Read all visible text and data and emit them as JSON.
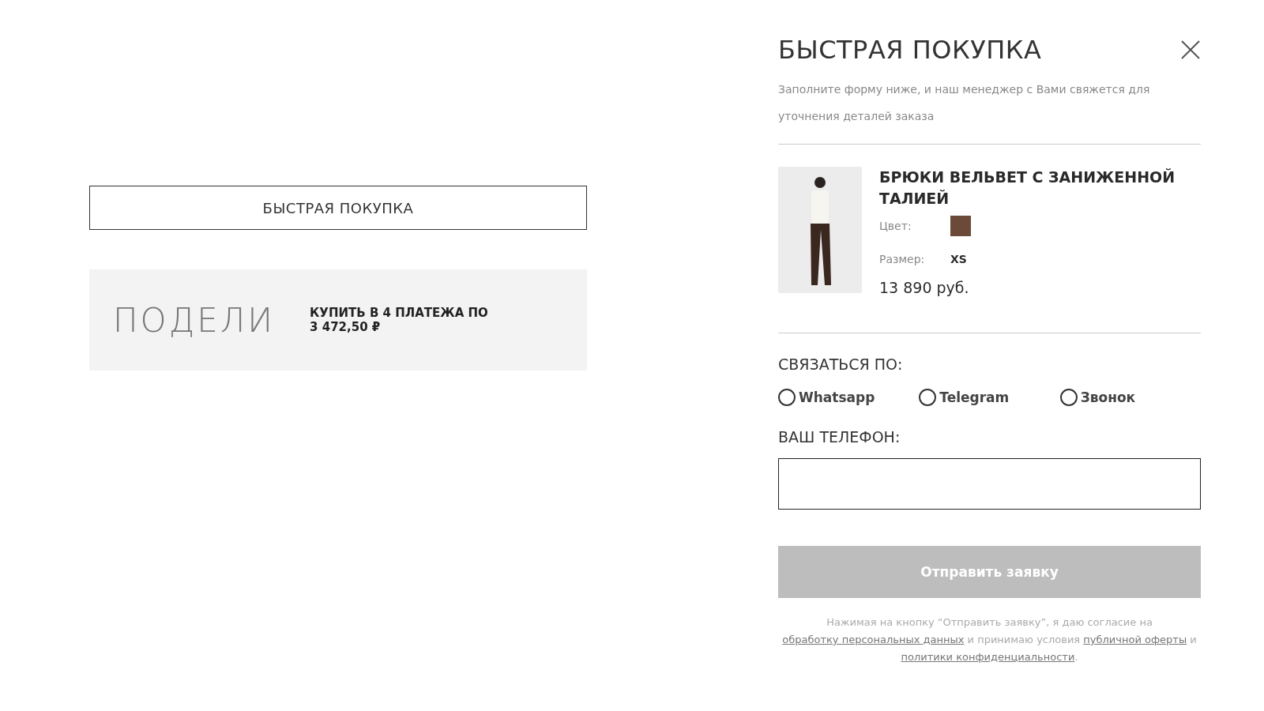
{
  "product_page": {
    "quick_buy_button": "БЫСТРАЯ ПОКУПКА",
    "installments": {
      "logo": "ПОДЕЛИ",
      "text": "КУПИТЬ В 4 ПЛАТЕЖА ПО",
      "amount": "3 472,50 ₽"
    }
  },
  "modal": {
    "title": "БЫСТРАЯ ПОКУПКА",
    "subtitle": "Заполните форму ниже, и наш менеджер с Вами свяжется для уточнения деталей заказа",
    "product": {
      "name": "БРЮКИ ВЕЛЬВЕТ С ЗАНИЖЕННОЙ ТАЛИЕЙ",
      "color_label": "Цвет:",
      "color": "#6b4a3a",
      "size_label": "Размер:",
      "size": "XS",
      "price": "13 890 руб."
    },
    "contact_label": "СВЯЗАТЬСЯ ПО:",
    "contact_options": [
      {
        "label": "Whatsapp",
        "selected": false
      },
      {
        "label": "Telegram",
        "selected": false
      },
      {
        "label": "Звонок",
        "selected": false
      }
    ],
    "phone_label": "ВАШ ТЕЛЕФОН:",
    "submit": {
      "label": "Отправить заявку",
      "disabled": true
    },
    "consent": [
      {
        "kind": "text",
        "text": "Нажимая на кнопку “Отправить заявку”, я даю согласие на "
      },
      {
        "kind": "link",
        "text": "обработку персональных данных"
      },
      {
        "kind": "text",
        "text": " и принимаю условия "
      },
      {
        "kind": "link",
        "text": "публичной оферты"
      },
      {
        "kind": "text",
        "text": " и "
      },
      {
        "kind": "link",
        "text": "политики конфиденциальности"
      },
      {
        "kind": "text",
        "text": "."
      }
    ]
  }
}
